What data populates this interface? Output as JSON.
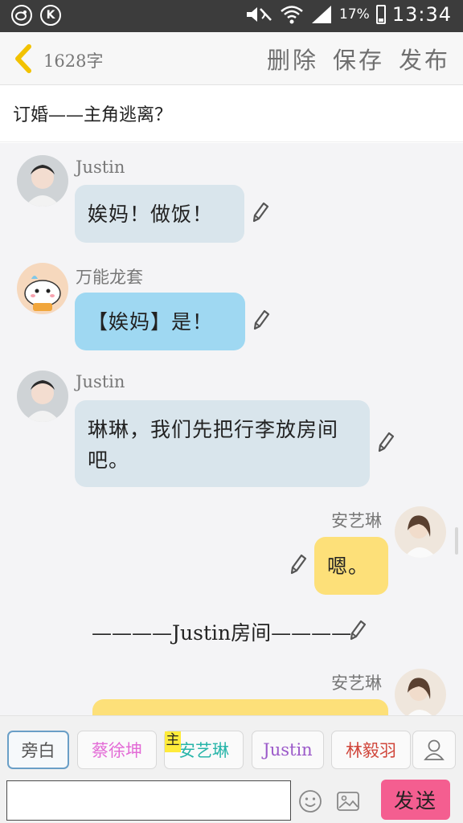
{
  "status_bar": {
    "battery_percent": "17%",
    "time": "13:34",
    "left_icons": [
      "weibo-icon",
      "k-circle-icon"
    ],
    "right_icons": [
      "mute-icon",
      "wifi-icon",
      "signal-icon",
      "battery-icon"
    ]
  },
  "header": {
    "word_count": "1628字",
    "delete_label": "删除",
    "save_label": "保存",
    "publish_label": "发布"
  },
  "title": "订婚——主角逃离？",
  "messages": [
    {
      "speaker": "Justin",
      "text": "娭妈！做饭！",
      "side": "left",
      "bubble": "gray"
    },
    {
      "speaker": "万能龙套",
      "text": "【娭妈】是！",
      "side": "left",
      "bubble": "blue"
    },
    {
      "speaker": "Justin",
      "text": "琳琳，我们先把行李放房间吧。",
      "side": "left",
      "bubble": "gray"
    },
    {
      "speaker": "安艺琳",
      "text": "嗯。",
      "side": "right",
      "bubble": "yellow"
    },
    {
      "narration": "————Justin房间————"
    },
    {
      "speaker": "安艺琳",
      "text": "",
      "side": "right",
      "bubble": "yellow"
    }
  ],
  "characters": [
    {
      "label": "旁白",
      "color": "#555555",
      "selected": true
    },
    {
      "label": "蔡徐坤",
      "color": "#e36bd6"
    },
    {
      "label": "安艺琳",
      "color": "#28b5a9",
      "tag": "主"
    },
    {
      "label": "Justin",
      "color": "#9b59c9"
    },
    {
      "label": "林毅羽",
      "color": "#d0453a"
    }
  ],
  "input": {
    "value": "",
    "placeholder": ""
  },
  "send_label": "发送",
  "colors": {
    "bubble_gray": "#d9e5ec",
    "bubble_blue": "#9fd8f2",
    "bubble_yellow": "#fde079",
    "send_button": "#f45e90",
    "back_arrow": "#f2c200"
  }
}
